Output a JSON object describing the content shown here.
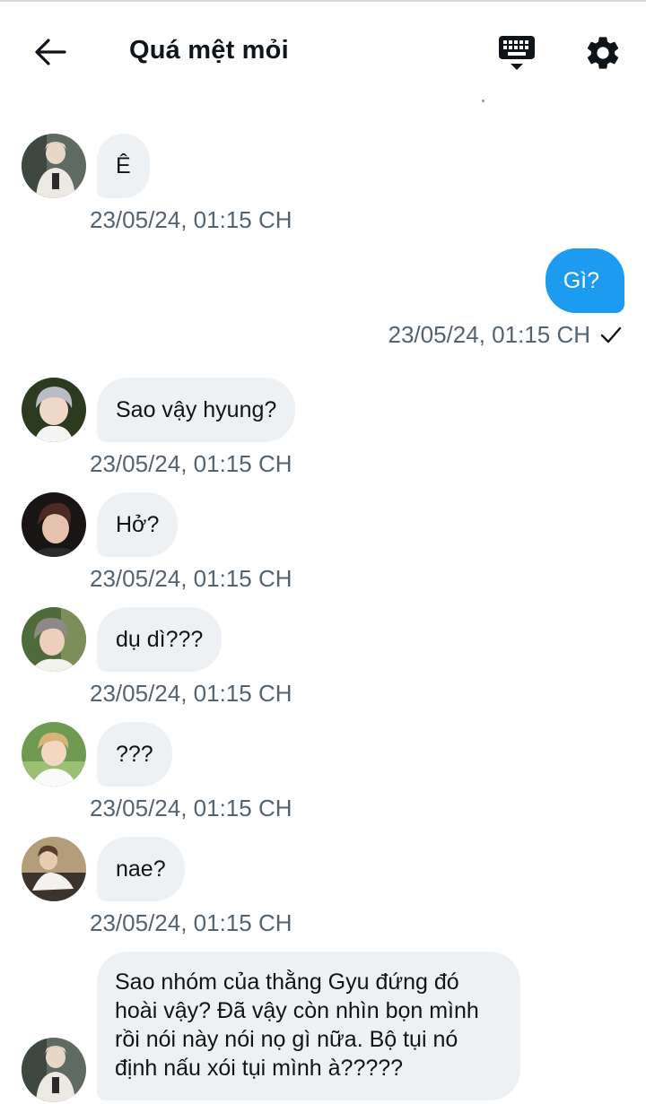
{
  "header": {
    "title": "Quá mệt mỏi",
    "back_icon": "arrow-left-icon",
    "keyboard_icon": "keyboard-icon",
    "settings_icon": "gear-icon"
  },
  "colors": {
    "outgoing_bubble": "#1d9bf0",
    "incoming_bubble": "#eef1f4",
    "timestamp": "#536471"
  },
  "messages": [
    {
      "direction": "in",
      "text": "Ê",
      "timestamp": "23/05/24, 01:15 CH"
    },
    {
      "direction": "out",
      "text": "Gì?",
      "timestamp": "23/05/24, 01:15 CH",
      "status_icon": "checkmark-icon"
    },
    {
      "direction": "in",
      "text": "Sao vậy hyung?",
      "timestamp": "23/05/24, 01:15 CH"
    },
    {
      "direction": "in",
      "text": "Hở?",
      "timestamp": "23/05/24, 01:15 CH"
    },
    {
      "direction": "in",
      "text": "dụ dì???",
      "timestamp": "23/05/24, 01:15 CH"
    },
    {
      "direction": "in",
      "text": "???",
      "timestamp": "23/05/24, 01:15 CH"
    },
    {
      "direction": "in",
      "text": "nae?",
      "timestamp": "23/05/24, 01:15 CH"
    },
    {
      "direction": "in",
      "text": "Sao nhóm của thằng Gyu đứng đó hoài vậy? Đã vậy còn nhìn bọn mình rồi nói này nói nọ gì nữa. Bộ tụi nó định nấu xói tụi mình à?????",
      "timestamp": ""
    }
  ]
}
